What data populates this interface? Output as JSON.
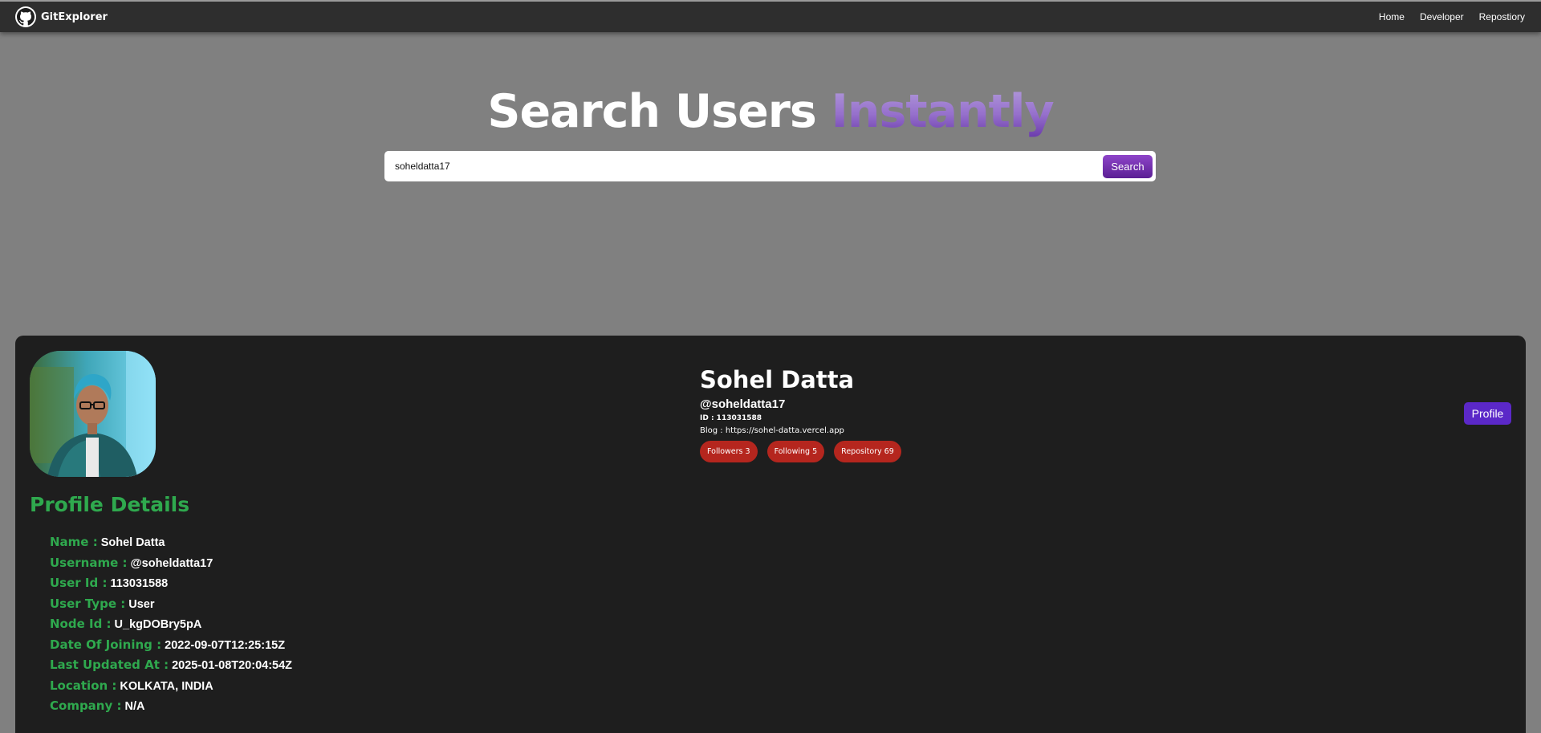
{
  "navbar": {
    "brand": "GitExplorer",
    "links": [
      "Home",
      "Developer",
      "Repostiory"
    ]
  },
  "hero": {
    "title_main": "Search Users",
    "title_accent": "Instantly"
  },
  "search": {
    "value": "soheldatta17",
    "button_label": "Search"
  },
  "profile": {
    "full_name": "Sohel Datta",
    "handle": "@soheldatta17",
    "id_line": "ID : 113031588",
    "blog_line": "Blog : https://sohel-datta.vercel.app",
    "badges": [
      "Followers 3",
      "Following 5",
      "Repository 69"
    ],
    "profile_button": "Profile"
  },
  "details": {
    "heading": "Profile Details",
    "rows": [
      {
        "label": "Name :",
        "value": "Sohel Datta"
      },
      {
        "label": "Username :",
        "value": "@soheldatta17"
      },
      {
        "label": "User Id :",
        "value": "113031588"
      },
      {
        "label": "User Type :",
        "value": "User"
      },
      {
        "label": "Node Id :",
        "value": "U_kgDOBry5pA"
      },
      {
        "label": "Date Of Joining :",
        "value": "2022-09-07T12:25:15Z"
      },
      {
        "label": "Last Updated At :",
        "value": "2025-01-08T20:04:54Z"
      },
      {
        "label": "Location :",
        "value": "KOLKATA, INDIA"
      },
      {
        "label": "Company :",
        "value": "N/A"
      }
    ]
  },
  "colors": {
    "page_bg": "#808080",
    "navbar_bg": "#2e2e2e",
    "card_bg": "#1e1e1e",
    "accent_green": "#2fa94e",
    "badge_red": "#b5261e",
    "profile_button": "#5b28c8",
    "search_button": "#7a35b8"
  },
  "icons": {
    "brand_logo": "github-icon"
  }
}
